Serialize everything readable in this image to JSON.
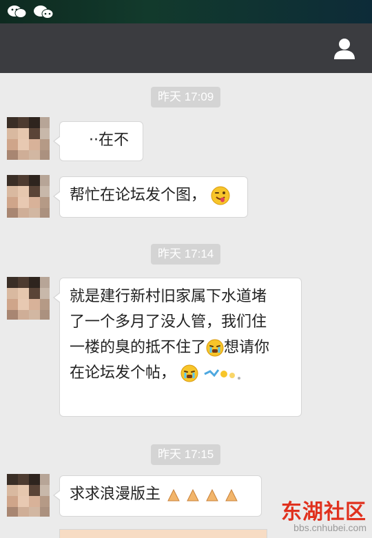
{
  "header": {
    "title": "",
    "profile_icon": "person-icon",
    "status_icons": [
      "wechat-icon",
      "wechat-moments-icon"
    ]
  },
  "messages": [
    {
      "timestamp": "昨天 17:09",
      "bubbles": [
        "··在不"
      ]
    },
    {
      "bubbles": [
        "帮忙在论坛发个图，"
      ],
      "emoji": "tongue-wink-emoji"
    },
    {
      "timestamp": "昨天 17:14",
      "bubbles": [
        "就是建行新村旧家属下水道堵",
        "了一个多月了没人管，我们住",
        "一楼的臭的抵不住了",
        "想请你",
        "在论坛发个帖，"
      ]
    },
    {
      "timestamp": "昨天 17:15",
      "bubbles": [
        "求求浪漫版主"
      ],
      "emoji": "pray-hands-emoji"
    }
  ],
  "watermark": {
    "title": "东湖社区",
    "url": "bbs.cnhubei.com"
  },
  "colors": {
    "titlebar": "#3b3c40",
    "background": "#ebebeb",
    "timestamp_bg": "#d4d4d4",
    "watermark": "#e0311e"
  }
}
